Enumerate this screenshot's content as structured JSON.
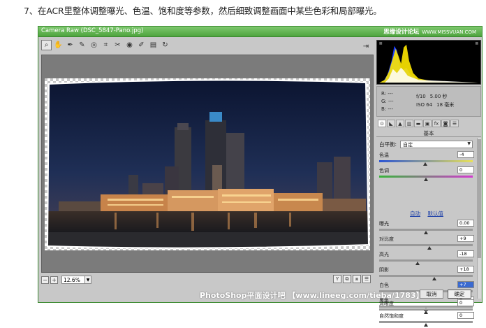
{
  "instruction": "7、在ACR里整体调整曝光、色温、饱和度等参数，然后细致调整画面中某些色彩和局部曝光。",
  "window": {
    "title": "Camera Raw (DSC_5847-Pano.jpg)",
    "watermark": "思缘设计论坛",
    "watermark_url": "WWW.MISSVUAN.COM"
  },
  "toolbar": {
    "tools": [
      {
        "name": "zoom-tool",
        "glyph": "⌕"
      },
      {
        "name": "hand-tool",
        "glyph": "✋"
      },
      {
        "name": "white-balance-tool",
        "glyph": "✒"
      },
      {
        "name": "color-sampler-tool",
        "glyph": "✎"
      },
      {
        "name": "target-adjust-tool",
        "glyph": "◎"
      },
      {
        "name": "crop-tool",
        "glyph": "⌗"
      },
      {
        "name": "spot-removal-tool",
        "glyph": "✂"
      },
      {
        "name": "red-eye-tool",
        "glyph": "◉"
      },
      {
        "name": "adjustment-brush-tool",
        "glyph": "✐"
      },
      {
        "name": "graduated-filter-tool",
        "glyph": "▤"
      },
      {
        "name": "rotate-tool",
        "glyph": "↻"
      }
    ],
    "export_glyph": "⇥"
  },
  "info": {
    "r": "R:  ---",
    "g": "G:  ---",
    "b": "B:  ---",
    "aperture": "f/10",
    "shutter": "5.00 秒",
    "iso": "ISO 64",
    "focal": "18 毫米"
  },
  "panel": {
    "title": "基本",
    "tabs": [
      "⊙",
      "◣",
      "▲",
      "▥",
      "▬",
      "▣",
      "fx",
      "◙",
      "☰"
    ],
    "wb_label": "白平衡:",
    "wb_value": "自定",
    "links": {
      "auto": "自动",
      "default": "默认值"
    },
    "sliders_top": [
      {
        "label": "色温",
        "value": "-4",
        "pos": 0.49,
        "track": "temp"
      },
      {
        "label": "色调",
        "value": "0",
        "pos": 0.5,
        "track": "tint"
      }
    ],
    "sliders_tone": [
      {
        "label": "曝光",
        "value": "0.00",
        "pos": 0.5
      },
      {
        "label": "对比度",
        "value": "+9",
        "pos": 0.54
      },
      {
        "label": "高光",
        "value": "-18",
        "pos": 0.41
      },
      {
        "label": "阴影",
        "value": "+18",
        "pos": 0.59
      },
      {
        "label": "白色",
        "value": "+7",
        "pos": 0.53,
        "highlight": true
      },
      {
        "label": "黑色",
        "value": "0",
        "pos": 0.5
      }
    ],
    "sliders_presence": [
      {
        "label": "清晰度",
        "value": "0",
        "pos": 0.5
      },
      {
        "label": "自然饱和度",
        "value": "0",
        "pos": 0.5
      }
    ]
  },
  "bottom": {
    "zoom": "12.6%",
    "zoom_minus": "−",
    "zoom_plus": "+",
    "view_buttons": [
      "Y",
      "⧉",
      "⧈",
      "☰"
    ],
    "watermark": "PhotoShop平面设计吧 【www.lineeg.com/tieba/1783】",
    "cancel": "取消",
    "ok": "确定"
  },
  "colors": {
    "title_bar": "#4ea43e",
    "histogram_blue": "#1c3cff",
    "histogram_yellow": "#ffe800",
    "link_blue": "#1a3ea8"
  }
}
